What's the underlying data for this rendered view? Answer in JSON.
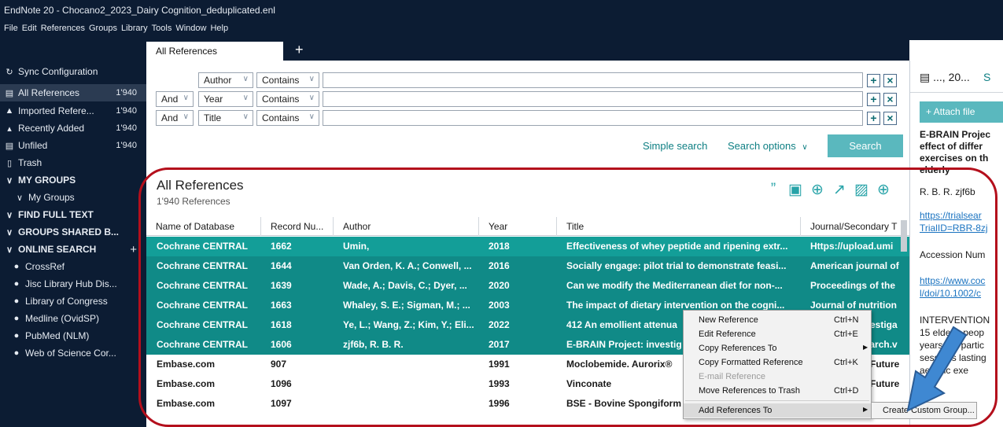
{
  "window": {
    "title": "EndNote 20 - Chocano2_2023_Dairy Cognition_deduplicated.enl",
    "menu": [
      "File",
      "Edit",
      "References",
      "Groups",
      "Library",
      "Tools",
      "Window",
      "Help"
    ]
  },
  "sidebar": {
    "sync": "Sync Configuration",
    "items": [
      {
        "label": "All References",
        "count": "1'940",
        "icon": "library-icon"
      },
      {
        "label": "Imported Refere...",
        "count": "1'940",
        "icon": "import-icon"
      },
      {
        "label": "Recently Added",
        "count": "1'940",
        "icon": "bell-icon"
      },
      {
        "label": "Unfiled",
        "count": "1'940",
        "icon": "library-icon"
      },
      {
        "label": "Trash",
        "count": "",
        "icon": "trash-icon"
      }
    ],
    "my_groups": "MY GROUPS",
    "my_groups_sub": "My Groups",
    "find_full_text": "FIND FULL TEXT",
    "groups_shared": "GROUPS SHARED B...",
    "online_search": "ONLINE SEARCH",
    "online_search_add": "+",
    "online_items": [
      "CrossRef",
      "Jisc Library Hub Dis...",
      "Library of Congress",
      "Medline (OvidSP)",
      "PubMed (NLM)",
      "Web of Science Cor..."
    ]
  },
  "tabs": {
    "active": "All References",
    "add": "+"
  },
  "search": {
    "rows": [
      {
        "bool": "",
        "field": "Author",
        "op": "Contains",
        "value": ""
      },
      {
        "bool": "And",
        "field": "Year",
        "op": "Contains",
        "value": ""
      },
      {
        "bool": "And",
        "field": "Title",
        "op": "Contains",
        "value": ""
      }
    ],
    "plus": "+",
    "remove": "×",
    "simple_search": "Simple search",
    "search_options": "Search options",
    "search_button": "Search"
  },
  "library": {
    "title": "All References",
    "count": "1'940 References"
  },
  "table": {
    "columns": [
      "Name of Database",
      "Record Nu...",
      "Author",
      "Year",
      "Title",
      "Journal/Secondary T"
    ],
    "rows": [
      {
        "db": "Cochrane CENTRAL",
        "rec": "1662",
        "author": "Umin,",
        "year": "2018",
        "title": "Effectiveness of whey peptide and ripening extr...",
        "journal": "Https://upload.umi",
        "selected": true
      },
      {
        "db": "Cochrane CENTRAL",
        "rec": "1644",
        "author": "Van Orden, K. A.; Conwell, ...",
        "year": "2016",
        "title": "Socially engage: pilot trial to demonstrate feasi...",
        "journal": "American journal of",
        "selected": true
      },
      {
        "db": "Cochrane CENTRAL",
        "rec": "1639",
        "author": "Wade, A.; Davis, C.; Dyer, ...",
        "year": "2020",
        "title": "Can we modify the Mediterranean diet for non-...",
        "journal": "Proceedings of the",
        "selected": true
      },
      {
        "db": "Cochrane CENTRAL",
        "rec": "1663",
        "author": "Whaley, S. E.; Sigman, M.; ...",
        "year": "2003",
        "title": "The impact of dietary intervention on the cogni...",
        "journal": "Journal of nutrition",
        "selected": true
      },
      {
        "db": "Cochrane CENTRAL",
        "rec": "1618",
        "author": "Ye, L.; Wang, Z.; Kim, Y.; Eli...",
        "year": "2022",
        "title": "412 An emollient attenua",
        "journal": "nvestiga",
        "selected": true
      },
      {
        "db": "Cochrane CENTRAL",
        "rec": "1606",
        "author": "zjf6b, R. B. R.",
        "year": "2017",
        "title": "E-BRAIN Project: investig",
        "journal": "search.v",
        "selected": true
      },
      {
        "db": "Embase.com",
        "rec": "907",
        "author": "",
        "year": "1991",
        "title": "Moclobemide. Aurorix®",
        "journal": "Future",
        "selected": false
      },
      {
        "db": "Embase.com",
        "rec": "1096",
        "author": "",
        "year": "1993",
        "title": "Vinconate",
        "journal": "Future",
        "selected": false
      },
      {
        "db": "Embase.com",
        "rec": "1097",
        "author": "",
        "year": "1996",
        "title": "BSE - Bovine Spongiform",
        "journal": "",
        "selected": false
      }
    ]
  },
  "preview": {
    "title": "..., 20...",
    "tab": "S",
    "attach": "+ Attach file",
    "heading": [
      "E-BRAIN Projec",
      "effect of differ",
      "exercises on th",
      "elderly"
    ],
    "author": "R. B. R. zjf6b",
    "link1": [
      "https://trialsear",
      "TrialID=RBR-8zj"
    ],
    "accession": "Accession Num",
    "link2": [
      "https://www.coc",
      "l/doi/10.1002/c"
    ],
    "body": [
      "INTERVENTION",
      "15 elderly peop",
      "years will partic",
      "sessions lasting",
      "aerobic exe"
    ]
  },
  "context_menu": {
    "items": [
      {
        "label": "New Reference",
        "shortcut": "Ctrl+N",
        "disabled": false,
        "submenu": false
      },
      {
        "label": "Edit Reference",
        "shortcut": "Ctrl+E",
        "disabled": false,
        "submenu": false
      },
      {
        "label": "Copy References To",
        "shortcut": "",
        "disabled": false,
        "submenu": true
      },
      {
        "label": "Copy Formatted Reference",
        "shortcut": "Ctrl+K",
        "disabled": false,
        "submenu": false
      },
      {
        "label": "E-mail Reference",
        "shortcut": "",
        "disabled": true,
        "submenu": false
      },
      {
        "label": "Move References to Trash",
        "shortcut": "Ctrl+D",
        "disabled": false,
        "submenu": false
      },
      {
        "label": "Add References To",
        "shortcut": "",
        "disabled": false,
        "submenu": true
      }
    ],
    "submenu_item": "Create Custom Group..."
  },
  "annotation": {
    "ring_color": "#b40f1c",
    "arrow_color": "#3f88d2"
  }
}
